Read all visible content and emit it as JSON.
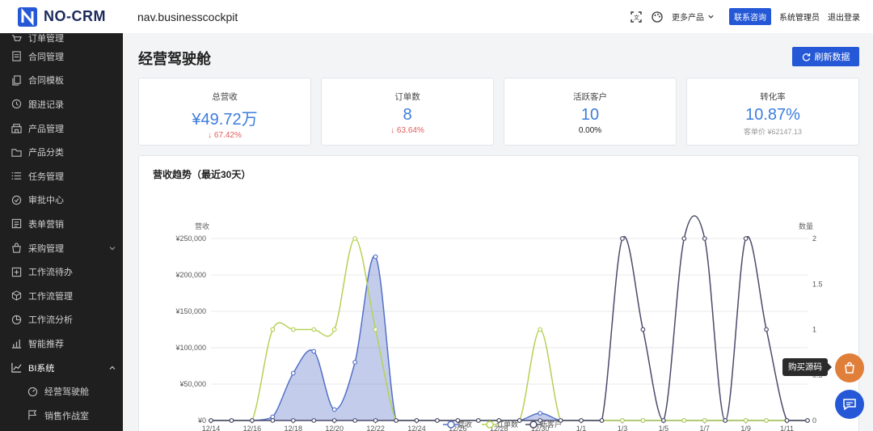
{
  "app": {
    "logo_text": "NO-CRM",
    "url": "nav.businesscockpit"
  },
  "topbar": {
    "more_products": "更多产品",
    "contact": "联系咨询",
    "admin": "系统管理员",
    "logout": "退出登录"
  },
  "sidebar": {
    "items": [
      {
        "label": "订单管理",
        "icon": "cart-icon"
      },
      {
        "label": "合同管理",
        "icon": "contract-icon"
      },
      {
        "label": "合同模板",
        "icon": "template-icon"
      },
      {
        "label": "跟进记录",
        "icon": "history-icon"
      },
      {
        "label": "产品管理",
        "icon": "shop-icon"
      },
      {
        "label": "产品分类",
        "icon": "folder-icon"
      },
      {
        "label": "任务管理",
        "icon": "list-icon"
      },
      {
        "label": "审批中心",
        "icon": "check-circle-icon"
      },
      {
        "label": "表单营销",
        "icon": "form-icon"
      },
      {
        "label": "采购管理",
        "icon": "bag-icon"
      },
      {
        "label": "工作流待办",
        "icon": "add-box-icon"
      },
      {
        "label": "工作流管理",
        "icon": "cube-icon"
      },
      {
        "label": "工作流分析",
        "icon": "pie-icon"
      },
      {
        "label": "智能推荐",
        "icon": "bar-icon"
      },
      {
        "label": "BI系统",
        "icon": "trend-icon"
      },
      {
        "label": "经营驾驶舱",
        "icon": "dashboard-icon"
      },
      {
        "label": "销售作战室",
        "icon": "flag-icon"
      }
    ]
  },
  "page": {
    "title": "经营驾驶舱",
    "refresh": "刷新数据"
  },
  "kpis": [
    {
      "label": "总营收",
      "value": "¥49.72万",
      "sub": "↓ 67.42%"
    },
    {
      "label": "订单数",
      "value": "8",
      "sub": "↓ 63.64%"
    },
    {
      "label": "活跃客户",
      "value": "10",
      "sub": "0.00%"
    },
    {
      "label": "转化率",
      "value": "10.87%",
      "sub": "客单价 ¥62147.13"
    }
  ],
  "chart_title": "营收趋势（最近30天）",
  "chart_data": {
    "type": "line",
    "title": "营收趋势（最近30天）",
    "ylabel_left": "营收",
    "ylabel_right": "数量",
    "ylim_left": [
      0,
      250000
    ],
    "ylim_right": [
      0,
      2
    ],
    "yticks_left": [
      "¥0",
      "¥50,000",
      "¥100,000",
      "¥150,000",
      "¥200,000",
      "¥250,000"
    ],
    "yticks_right": [
      "0",
      "0.5",
      "1",
      "1.5",
      "2"
    ],
    "xtick_labels": [
      "12/14",
      "12/16",
      "12/18",
      "12/20",
      "12/22",
      "12/24",
      "12/26",
      "12/28",
      "12/30",
      "1/1",
      "1/3",
      "1/5",
      "1/7",
      "1/9",
      "1/11"
    ],
    "x": [
      "12/14",
      "12/15",
      "12/16",
      "12/17",
      "12/18",
      "12/19",
      "12/20",
      "12/21",
      "12/22",
      "12/23",
      "12/24",
      "12/25",
      "12/26",
      "12/27",
      "12/28",
      "12/29",
      "12/30",
      "12/31",
      "1/1",
      "1/2",
      "1/3",
      "1/4",
      "1/5",
      "1/6",
      "1/7",
      "1/8",
      "1/9",
      "1/10",
      "1/11",
      "1/12"
    ],
    "series": [
      {
        "name": "营收",
        "axis": "left",
        "color": "#5470c6",
        "area": true,
        "values": [
          0,
          0,
          0,
          5000,
          65000,
          95000,
          15000,
          80000,
          225000,
          0,
          0,
          0,
          0,
          0,
          0,
          0,
          10000,
          0,
          0,
          0,
          0,
          0,
          0,
          0,
          0,
          0,
          0,
          0,
          0,
          0
        ]
      },
      {
        "name": "订单数",
        "axis": "right",
        "color": "#b5d155",
        "area": false,
        "values": [
          0,
          0,
          0,
          1,
          1,
          1,
          1,
          2,
          1,
          0,
          0,
          0,
          0,
          0,
          0,
          0,
          1,
          0,
          0,
          0,
          0,
          0,
          0,
          0,
          0,
          0,
          0,
          0,
          0,
          0
        ]
      },
      {
        "name": "新客户",
        "axis": "right",
        "color": "#4a4a6a",
        "area": false,
        "values": [
          0,
          0,
          0,
          0,
          0,
          0,
          0,
          0,
          0,
          0,
          0,
          0,
          0,
          0,
          0,
          0,
          0,
          0,
          0,
          0,
          2,
          1,
          0,
          2,
          2,
          0,
          2,
          1,
          0,
          0
        ]
      }
    ],
    "grid": true,
    "legend": "bottom"
  },
  "floating": {
    "tooltip": "购买源码"
  }
}
